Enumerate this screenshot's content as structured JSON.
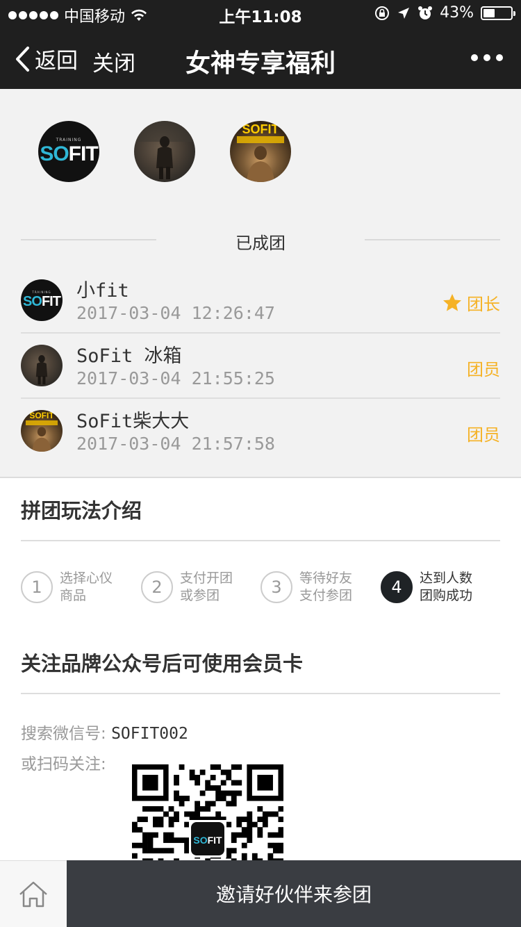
{
  "status_bar": {
    "carrier": "中国移动",
    "time": "上午11:08",
    "battery": "43%",
    "battery_level": 0.43
  },
  "nav": {
    "back_label": "返回",
    "close_label": "关闭",
    "title": "女神专享福利"
  },
  "group": {
    "avatars": [
      {
        "type": "sofit-logo"
      },
      {
        "type": "photo"
      },
      {
        "type": "photo-sofit"
      }
    ],
    "status_label": "已成团",
    "members": [
      {
        "name": "小fit",
        "time": "2017-03-04 12:26:47",
        "role": "团长",
        "icon": "star-icon"
      },
      {
        "name": "SoFit 冰箱",
        "time": "2017-03-04 21:55:25",
        "role": "团员"
      },
      {
        "name": "SoFit柴大大",
        "time": "2017-03-04 21:57:58",
        "role": "团员"
      }
    ]
  },
  "rules": {
    "title": "拼团玩法介绍",
    "steps": [
      {
        "num": "1",
        "line1": "选择心仪",
        "line2": "商品",
        "active": false
      },
      {
        "num": "2",
        "line1": "支付开团",
        "line2": "或参团",
        "active": false
      },
      {
        "num": "3",
        "line1": "等待好友",
        "line2": "支付参团",
        "active": false
      },
      {
        "num": "4",
        "line1": "达到人数",
        "line2": "团购成功",
        "active": true
      }
    ]
  },
  "follow": {
    "title": "关注品牌公众号后可使用会员卡",
    "search_label": "搜索微信号:",
    "search_value": "SOFIT002",
    "scan_label": "或扫码关注:"
  },
  "logo": {
    "training": "TRAINING",
    "so": "SO",
    "fit": "FIT"
  },
  "bottom": {
    "invite_label": "邀请好伙伴来参团"
  },
  "colors": {
    "dark": "#1f1f1f",
    "accent": "#f5b226",
    "button": "#3a3d42"
  }
}
